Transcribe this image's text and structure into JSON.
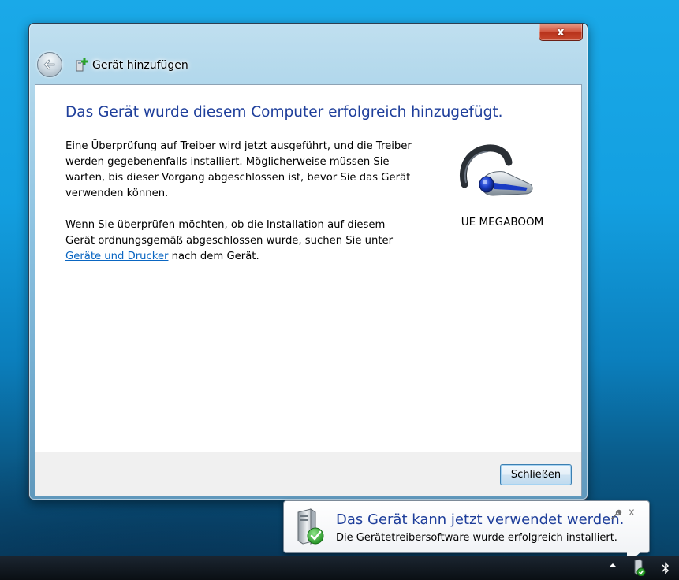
{
  "window": {
    "title": "Gerät hinzufügen",
    "close_label": "x"
  },
  "content": {
    "heading": "Das Gerät wurde diesem Computer erfolgreich hinzugefügt.",
    "paragraph1": "Eine Überprüfung auf Treiber wird jetzt ausgeführt, und die Treiber werden gegebenenfalls installiert. Möglicherweise müssen Sie warten, bis dieser Vorgang abgeschlossen ist, bevor Sie das Gerät verwenden können.",
    "paragraph2_before": "Wenn Sie überprüfen möchten, ob die Installation auf diesem Gerät ordnungsgemäß abgeschlossen wurde, suchen Sie unter ",
    "paragraph2_link": "Geräte und Drucker",
    "paragraph2_after": " nach dem Gerät.",
    "device_name": "UE MEGABOOM",
    "device_icon": "bluetooth-headset-icon"
  },
  "footer": {
    "close_button": "Schließen"
  },
  "notification": {
    "title": "Das Gerät kann jetzt verwendet werden.",
    "text": "Die Gerätetreibersoftware wurde erfolgreich installiert.",
    "close_label": "x",
    "icon": "device-ready-icon"
  },
  "colors": {
    "heading": "#1f3f9b",
    "link": "#0a66c2",
    "desktop": "#139fe0"
  }
}
